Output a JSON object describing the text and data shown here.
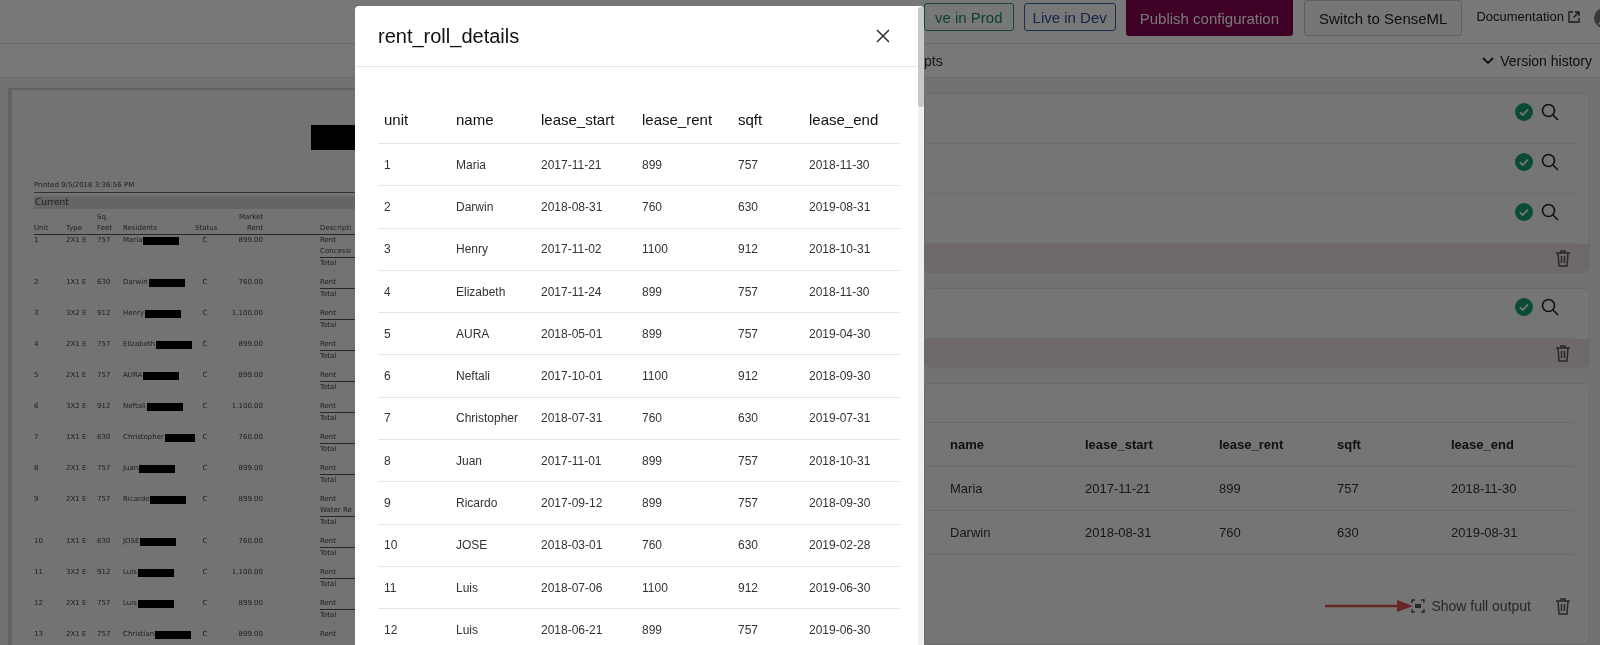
{
  "top_bar": {
    "buttons": [
      {
        "label": "ve in Prod",
        "kind": "prod"
      },
      {
        "label": "Live in Dev",
        "kind": "dev"
      },
      {
        "label": "Publish configuration",
        "kind": "primary"
      },
      {
        "label": "Switch to SenseML",
        "kind": "secondary"
      }
    ],
    "documentation": "Documentation"
  },
  "sub_bar": {
    "tab": "pts",
    "version_history": "Version history"
  },
  "document": {
    "printed": "Printed 9/5/2018 3:36:56 PM",
    "section": "Current",
    "columns": [
      [
        "Unit"
      ],
      [
        "Type"
      ],
      [
        "Sq.",
        "Feet"
      ],
      [
        "Residents"
      ],
      [
        "Status"
      ],
      [
        "Market",
        "Rent"
      ],
      [
        "Descripti"
      ]
    ],
    "rows": [
      {
        "unit": "1",
        "type": "2X1 E",
        "sqft": "757",
        "resident": "Maria",
        "status": "C",
        "market_rent": "899.00",
        "descriptions": [
          "Rent",
          "Concessi",
          "Total"
        ]
      },
      {
        "unit": "2",
        "type": "1X1 E",
        "sqft": "630",
        "resident": "Darwin",
        "status": "C",
        "market_rent": "760.00",
        "descriptions": [
          "Rent",
          "Total"
        ]
      },
      {
        "unit": "3",
        "type": "3X2 E",
        "sqft": "912",
        "resident": "Henry",
        "status": "C",
        "market_rent": "1,100.00",
        "descriptions": [
          "Rent",
          "Total"
        ]
      },
      {
        "unit": "4",
        "type": "2X1 E",
        "sqft": "757",
        "resident": "Elizabeth",
        "status": "C",
        "market_rent": "899.00",
        "descriptions": [
          "Rent",
          "Total"
        ]
      },
      {
        "unit": "5",
        "type": "2X1 E",
        "sqft": "757",
        "resident": "AURA",
        "status": "C",
        "market_rent": "899.00",
        "descriptions": [
          "Rent",
          "Total"
        ]
      },
      {
        "unit": "6",
        "type": "3X2 E",
        "sqft": "912",
        "resident": "Neftali",
        "status": "C",
        "market_rent": "1,100.00",
        "descriptions": [
          "Rent",
          "Total"
        ]
      },
      {
        "unit": "7",
        "type": "1X1 E",
        "sqft": "630",
        "resident": "Christopher",
        "status": "C",
        "market_rent": "760.00",
        "descriptions": [
          "Rent",
          "Total"
        ]
      },
      {
        "unit": "8",
        "type": "2X1 E",
        "sqft": "757",
        "resident": "Juan",
        "status": "C",
        "market_rent": "899.00",
        "descriptions": [
          "Rent",
          "Total"
        ]
      },
      {
        "unit": "9",
        "type": "2X1 E",
        "sqft": "757",
        "resident": "Ricardo",
        "status": "C",
        "market_rent": "899.00",
        "descriptions": [
          "Rent",
          "Water Re",
          "Total"
        ]
      },
      {
        "unit": "10",
        "type": "1X1 E",
        "sqft": "630",
        "resident": "JOSE",
        "status": "C",
        "market_rent": "760.00",
        "descriptions": [
          "Rent",
          "Total"
        ]
      },
      {
        "unit": "11",
        "type": "3X2 E",
        "sqft": "912",
        "resident": "Luis",
        "status": "C",
        "market_rent": "1,100.00",
        "descriptions": [
          "Rent",
          "Total"
        ]
      },
      {
        "unit": "12",
        "type": "2X1 E",
        "sqft": "757",
        "resident": "Luis",
        "status": "C",
        "market_rent": "899.00",
        "descriptions": [
          "Rent",
          "Total"
        ]
      },
      {
        "unit": "13",
        "type": "2X1 E",
        "sqft": "757",
        "resident": "Christian",
        "status": "C",
        "market_rent": "899.00",
        "descriptions": [
          "Rent"
        ]
      }
    ]
  },
  "results": {
    "cards": [
      {
        "fields": [
          {
            "validated": true
          },
          {
            "validated": true
          },
          {
            "validated": true
          }
        ]
      },
      {
        "fields": [
          {
            "validated": true
          }
        ]
      }
    ],
    "table": {
      "columns": [
        "name",
        "lease_start",
        "lease_rent",
        "sqft",
        "lease_end"
      ],
      "rows": [
        [
          "Maria",
          "2017-11-21",
          "899",
          "757",
          "2018-11-30"
        ],
        [
          "Darwin",
          "2018-08-31",
          "760",
          "630",
          "2019-08-31"
        ]
      ]
    },
    "show_full_output": "Show full output"
  },
  "modal": {
    "title": "rent_roll_details",
    "columns": [
      "unit",
      "name",
      "lease_start",
      "lease_rent",
      "sqft",
      "lease_end"
    ],
    "rows": [
      [
        "1",
        "Maria",
        "2017-11-21",
        "899",
        "757",
        "2018-11-30"
      ],
      [
        "2",
        "Darwin",
        "2018-08-31",
        "760",
        "630",
        "2019-08-31"
      ],
      [
        "3",
        "Henry",
        "2017-11-02",
        "1100",
        "912",
        "2018-10-31"
      ],
      [
        "4",
        "Elizabeth",
        "2017-11-24",
        "899",
        "757",
        "2018-11-30"
      ],
      [
        "5",
        "AURA",
        "2018-05-01",
        "899",
        "757",
        "2019-04-30"
      ],
      [
        "6",
        "Neftali",
        "2017-10-01",
        "1100",
        "912",
        "2018-09-30"
      ],
      [
        "7",
        "Christopher",
        "2018-07-31",
        "760",
        "630",
        "2019-07-31"
      ],
      [
        "8",
        "Juan",
        "2017-11-01",
        "899",
        "757",
        "2018-10-31"
      ],
      [
        "9",
        "Ricardo",
        "2017-09-12",
        "899",
        "757",
        "2018-09-30"
      ],
      [
        "10",
        "JOSE",
        "2018-03-01",
        "760",
        "630",
        "2019-02-28"
      ],
      [
        "11",
        "Luis",
        "2018-07-06",
        "1100",
        "912",
        "2019-06-30"
      ],
      [
        "12",
        "Luis",
        "2018-06-21",
        "899",
        "757",
        "2019-06-30"
      ]
    ]
  }
}
